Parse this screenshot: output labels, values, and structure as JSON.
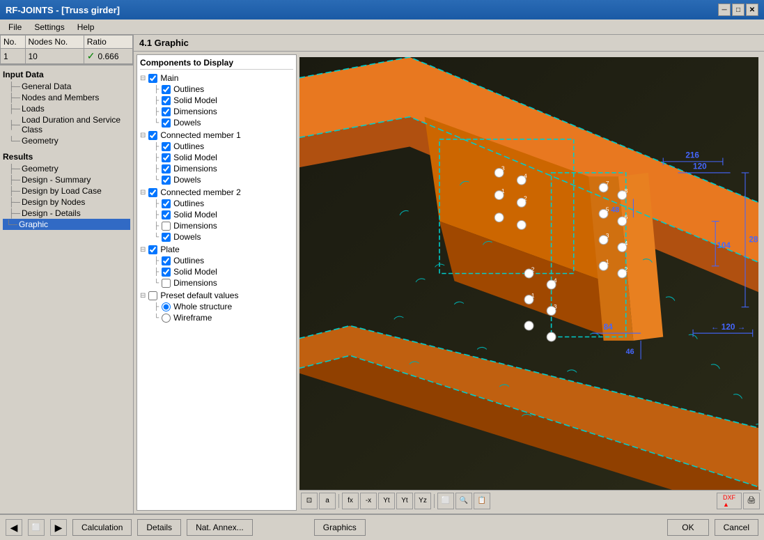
{
  "titleBar": {
    "title": "RF-JOINTS - [Truss girder]",
    "closeBtn": "✕",
    "minBtn": "─",
    "maxBtn": "□"
  },
  "menuBar": {
    "items": [
      "File",
      "Settings",
      "Help"
    ]
  },
  "table": {
    "columns": [
      "No.",
      "Nodes No.",
      "Ratio"
    ],
    "rows": [
      {
        "no": "1",
        "nodes": "10",
        "ratio": "0.666",
        "status": "ok"
      }
    ]
  },
  "inputData": {
    "header": "Input Data",
    "items": [
      "General Data",
      "Nodes and Members",
      "Loads",
      "Load Duration and Service Class",
      "Geometry"
    ]
  },
  "results": {
    "header": "Results",
    "items": [
      "Geometry",
      "Design - Summary",
      "Design by Load Case",
      "Design by Nodes",
      "Design - Details",
      "Graphic"
    ]
  },
  "sectionTitle": "4.1 Graphic",
  "componentsPanel": {
    "title": "Components to Display",
    "groups": [
      {
        "name": "Main",
        "checked": true,
        "items": [
          {
            "label": "Outlines",
            "checked": true
          },
          {
            "label": "Solid Model",
            "checked": true
          },
          {
            "label": "Dimensions",
            "checked": true
          },
          {
            "label": "Dowels",
            "checked": true
          }
        ]
      },
      {
        "name": "Connected member 1",
        "checked": true,
        "items": [
          {
            "label": "Outlines",
            "checked": true
          },
          {
            "label": "Solid Model",
            "checked": true
          },
          {
            "label": "Dimensions",
            "checked": true
          },
          {
            "label": "Dowels",
            "checked": true
          }
        ]
      },
      {
        "name": "Connected member 2",
        "checked": true,
        "items": [
          {
            "label": "Outlines",
            "checked": true
          },
          {
            "label": "Solid Model",
            "checked": true
          },
          {
            "label": "Dimensions",
            "checked": false
          },
          {
            "label": "Dowels",
            "checked": true
          }
        ]
      },
      {
        "name": "Plate",
        "checked": true,
        "items": [
          {
            "label": "Outlines",
            "checked": true
          },
          {
            "label": "Solid Model",
            "checked": true
          },
          {
            "label": "Dimensions",
            "checked": false
          }
        ]
      },
      {
        "name": "Preset default values",
        "checked": false,
        "items": [
          {
            "label": "Whole structure",
            "radio": true,
            "selected": true
          },
          {
            "label": "Wireframe",
            "radio": true,
            "selected": false
          }
        ]
      }
    ]
  },
  "viewportToolbar": {
    "buttons": [
      "⊡",
      "a",
      "fx",
      "-x",
      "Yt",
      "Yt",
      "Yz",
      "⬜",
      "🔍",
      "📋"
    ],
    "rightButtons": [
      "DXF",
      "▲"
    ]
  },
  "bottomBar": {
    "navBtns": [
      "◀",
      "⬜",
      "▶"
    ],
    "actionBtns": [
      "Calculation",
      "Details",
      "Nat. Annex..."
    ],
    "midBtn": "Graphics",
    "okBtn": "OK",
    "cancelBtn": "Cancel"
  },
  "colors": {
    "titleBg": "#1a6eb5",
    "accent": "#316ac5",
    "active": "#316ac5",
    "orange": "#e87820",
    "darkOrange": "#b05010",
    "teal": "#008080",
    "background": "#d4d0c8"
  }
}
